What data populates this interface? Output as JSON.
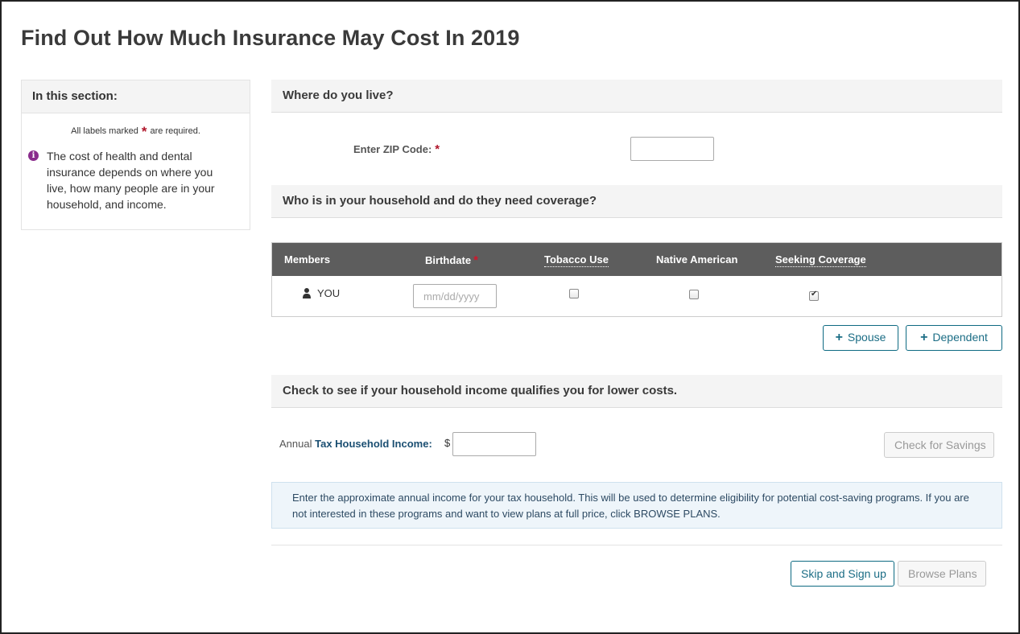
{
  "page": {
    "title": "Find Out How Much Insurance May Cost In 2019"
  },
  "sidebar": {
    "heading": "In this section:",
    "required_prefix": "All labels marked",
    "required_star": "*",
    "required_suffix": "are required.",
    "info_icon": "info-circle-icon",
    "info_text": "The cost of health and dental insurance depends on where you live, how many people are in your household, and income."
  },
  "location": {
    "heading": "Where do you live?",
    "zip_label": "Enter ZIP Code:",
    "required_star": "*",
    "zip_value": ""
  },
  "household": {
    "heading": "Who is in your household and do they need coverage?",
    "columns": {
      "members": "Members",
      "birthdate": "Birthdate",
      "tobacco": "Tobacco Use",
      "native": "Native American",
      "seeking": "Seeking Coverage"
    },
    "required_star": "*",
    "rows": [
      {
        "icon": "user-icon",
        "member": "YOU",
        "birthdate_placeholder": "mm/dd/yyyy",
        "tobacco": false,
        "native_american": false,
        "seeking_coverage": true
      }
    ],
    "add_spouse_label": "Spouse",
    "add_dependent_label": "Dependent",
    "plus_icon": "plus-icon",
    "plus_glyph": "+"
  },
  "income": {
    "heading": "Check to see if your household income qualifies you for lower costs.",
    "label_prefix": "Annual",
    "label_strong": "Tax Household Income:",
    "currency": "$",
    "value": "",
    "check_button": "Check for Savings",
    "info_text": "Enter the approximate annual income for your tax household. This will be used to determine eligibility for potential cost-saving programs. If you are not interested in these programs and want to view plans at full price, click BROWSE PLANS."
  },
  "footer": {
    "skip_button": "Skip and Sign up",
    "browse_button": "Browse Plans"
  },
  "colors": {
    "required": "#b0162b",
    "accent": "#1b6d85",
    "table_header": "#5d5d5d",
    "info_icon": "#8a2c8c"
  }
}
